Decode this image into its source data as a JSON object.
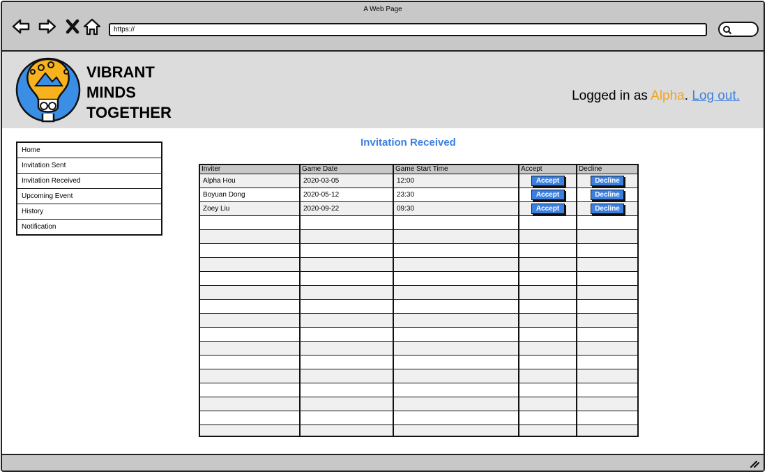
{
  "window": {
    "title": "A Web Page"
  },
  "browser": {
    "url": "https://",
    "icons": [
      "back-arrow-icon",
      "forward-arrow-icon",
      "close-x-icon",
      "home-icon",
      "search-icon"
    ]
  },
  "brand": {
    "line1": "VIBRANT",
    "line2": "MINDS",
    "line3": "TOGETHER"
  },
  "login": {
    "prefix": "Logged in as ",
    "user": "Alpha",
    "separator": ". ",
    "logout": "Log out."
  },
  "sidebar": {
    "items": [
      {
        "label": "Home"
      },
      {
        "label": "Invitation Sent"
      },
      {
        "label": "Invitation Received"
      },
      {
        "label": "Upcoming Event"
      },
      {
        "label": "History"
      },
      {
        "label": "Notification"
      }
    ]
  },
  "main": {
    "title": "Invitation Received",
    "columns": [
      "Inviter",
      "Game Date",
      "Game Start Time",
      "Accept",
      "Decline"
    ],
    "accept_label": "Accept",
    "decline_label": "Decline",
    "rows": [
      {
        "inviter": "Alpha Hou",
        "date": "2020-03-05",
        "time": "12:00"
      },
      {
        "inviter": "Boyuan Dong",
        "date": "2020-05-12",
        "time": "23:30"
      },
      {
        "inviter": "Zoey Liu",
        "date": "2020-09-22",
        "time": "09:30"
      }
    ]
  },
  "colors": {
    "accent": "#3b7fe0",
    "user_highlight": "#f3a21c",
    "header_band": "#dcdcdc",
    "chrome": "#c8c8c8"
  }
}
